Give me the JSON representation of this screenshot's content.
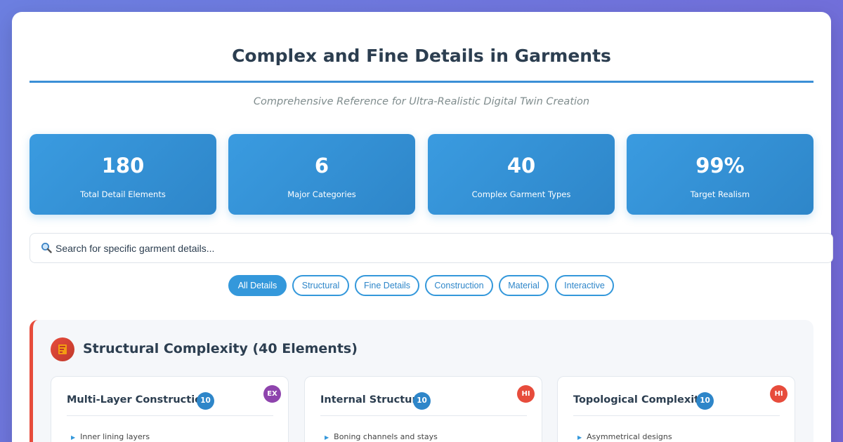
{
  "header": {
    "title": "Complex and Fine Details in Garments",
    "subtitle": "Comprehensive Reference for Ultra-Realistic Digital Twin Creation"
  },
  "stats": [
    {
      "value": "180",
      "label": "Total Detail Elements"
    },
    {
      "value": "6",
      "label": "Major Categories"
    },
    {
      "value": "40",
      "label": "Complex Garment Types"
    },
    {
      "value": "99%",
      "label": "Target Realism"
    }
  ],
  "search": {
    "icon": "magnifier-icon",
    "placeholder": "Search for specific garment details..."
  },
  "filters": [
    {
      "label": "All Details",
      "active": true
    },
    {
      "label": "Structural",
      "active": false
    },
    {
      "label": "Fine Details",
      "active": false
    },
    {
      "label": "Construction",
      "active": false
    },
    {
      "label": "Material",
      "active": false
    },
    {
      "label": "Interactive",
      "active": false
    }
  ],
  "section": {
    "title": "Structural Complexity (40 Elements)",
    "accent": "#e74c3c",
    "cards": [
      {
        "title": "Multi-Layer Construction",
        "count": "10",
        "level": "EX",
        "level_color": "#8e44ad",
        "first_item": "Inner lining layers"
      },
      {
        "title": "Internal Structure",
        "count": "10",
        "level": "HI",
        "level_color": "#e74c3c",
        "first_item": "Boning channels and stays"
      },
      {
        "title": "Topological Complexity",
        "count": "10",
        "level": "HI",
        "level_color": "#e74c3c",
        "first_item": "Asymmetrical designs"
      }
    ]
  },
  "colors": {
    "accent": "#3498db",
    "title": "#2c3e50",
    "background": "#7466d6"
  }
}
